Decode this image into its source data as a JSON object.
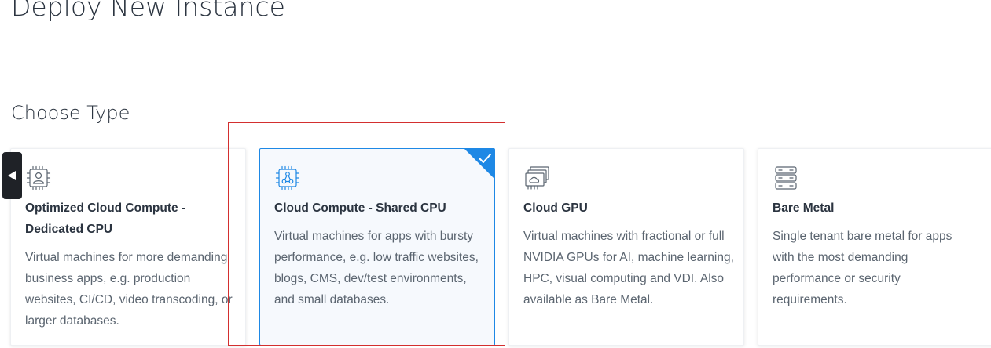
{
  "page": {
    "title": "Deploy New Instance"
  },
  "section": {
    "title": "Choose Type"
  },
  "colors": {
    "accent": "#1e88e5",
    "selected_background": "#f6f9fd",
    "annotation_box": "#d32f2f",
    "handle": "#1f2227"
  },
  "cards": [
    {
      "icon": "cpu-user-icon",
      "title": "Optimized Cloud Compute - Dedicated CPU",
      "description": "Virtual machines for more demanding business apps, e.g. production websites, CI/CD, video transcoding, or larger databases.",
      "selected": false
    },
    {
      "icon": "cpu-network-icon",
      "title": "Cloud Compute - Shared CPU",
      "description": "Virtual machines for apps with bursty performance, e.g. low traffic websites, blogs, CMS, dev/test environments, and small databases.",
      "selected": true
    },
    {
      "icon": "gpu-card-icon",
      "title": "Cloud GPU",
      "description": "Virtual machines with fractional or full NVIDIA GPUs for AI, machine learning, HPC, visual computing and VDI. Also available as Bare Metal.",
      "selected": false
    },
    {
      "icon": "server-rack-icon",
      "title": "Bare Metal",
      "description": "Single tenant bare metal for apps with the most demanding performance or security requirements.",
      "selected": false
    }
  ],
  "collapse_handle": {
    "icon": "caret-left-icon"
  },
  "selection_indicator": {
    "icon": "checkmark-icon"
  }
}
